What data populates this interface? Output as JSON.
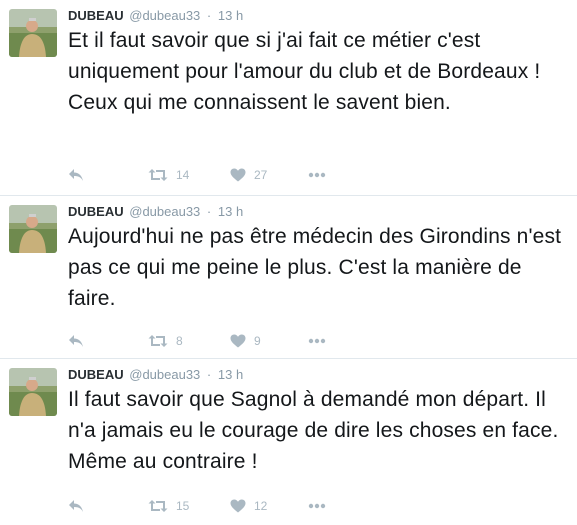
{
  "tweets": [
    {
      "name": "DUBEAU",
      "handle": "@dubeau33",
      "separator": "·",
      "time": "13 h",
      "text": "Et il faut savoir que si j'ai fait ce métier c'est uniquement pour l'amour du club et de Bordeaux ! Ceux qui me connaissent le savent bien.",
      "retweets": "14",
      "likes": "27"
    },
    {
      "name": "DUBEAU",
      "handle": "@dubeau33",
      "separator": "·",
      "time": "13 h",
      "text": "Aujourd'hui ne pas être médecin des Girondins n'est pas ce qui me peine le plus. C'est la manière de faire.",
      "retweets": "8",
      "likes": "9"
    },
    {
      "name": "DUBEAU",
      "handle": "@dubeau33",
      "separator": "·",
      "time": "13 h",
      "text": "Il faut savoir que Sagnol à demandé mon départ. Il n'a jamais eu le courage de dire les choses en face. Même au contraire !",
      "retweets": "15",
      "likes": "12"
    }
  ],
  "icons": {
    "reply": "reply-icon",
    "retweet": "retweet-icon",
    "like": "heart-icon",
    "more": "more-icon"
  },
  "colors": {
    "icon": "#aab8c2",
    "meta": "#8899a6",
    "text": "#14171a",
    "divider": "#e1e8ed"
  }
}
